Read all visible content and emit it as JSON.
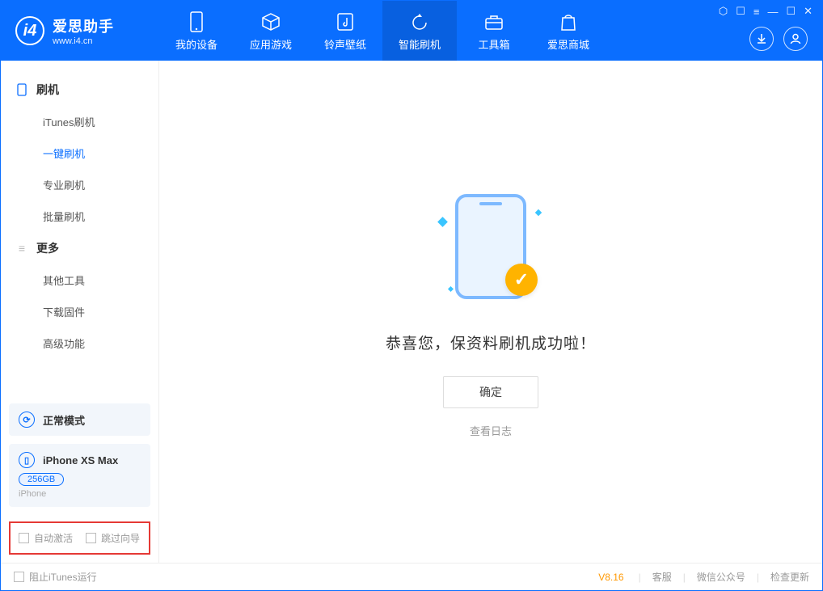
{
  "header": {
    "app_name": "爱思助手",
    "url": "www.i4.cn",
    "tabs": [
      {
        "label": "我的设备",
        "icon": "phone"
      },
      {
        "label": "应用游戏",
        "icon": "cube"
      },
      {
        "label": "铃声壁纸",
        "icon": "music"
      },
      {
        "label": "智能刷机",
        "icon": "refresh"
      },
      {
        "label": "工具箱",
        "icon": "toolbox"
      },
      {
        "label": "爱思商城",
        "icon": "bag"
      }
    ],
    "active_tab_index": 3
  },
  "sidebar": {
    "groups": [
      {
        "title": "刷机",
        "icon": "device",
        "items": [
          "iTunes刷机",
          "一键刷机",
          "专业刷机",
          "批量刷机"
        ],
        "active_index": 1
      },
      {
        "title": "更多",
        "icon": "menu",
        "items": [
          "其他工具",
          "下载固件",
          "高级功能"
        ],
        "active_index": -1
      }
    ],
    "mode_block": {
      "label": "正常模式"
    },
    "device": {
      "name": "iPhone XS Max",
      "storage": "256GB",
      "type": "iPhone"
    },
    "checkboxes": {
      "auto_activate": "自动激活",
      "skip_guide": "跳过向导"
    }
  },
  "main": {
    "success_title": "恭喜您，保资料刷机成功啦！",
    "confirm_button": "确定",
    "view_log_link": "查看日志"
  },
  "footer": {
    "block_itunes": "阻止iTunes运行",
    "version": "V8.16",
    "links": [
      "客服",
      "微信公众号",
      "检查更新"
    ]
  }
}
